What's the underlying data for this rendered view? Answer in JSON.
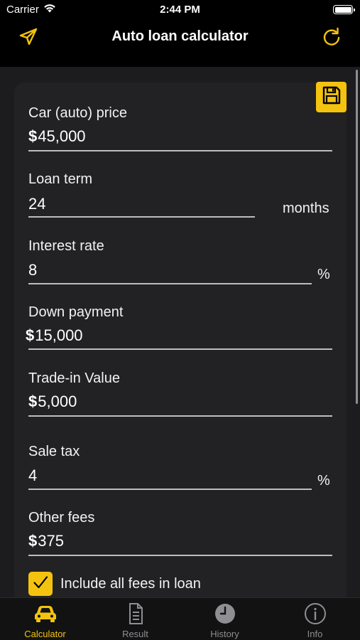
{
  "status_bar": {
    "carrier": "Carrier",
    "time": "2:44 PM"
  },
  "nav": {
    "title": "Auto loan calculator",
    "left_icon": "send-icon",
    "right_icon": "refresh-icon"
  },
  "colors": {
    "accent": "#f4c30f",
    "background": "#000000",
    "panel": "#222224",
    "muted": "#8e8e93"
  },
  "form": {
    "car_price": {
      "label": "Car (auto) price",
      "prefix": "$",
      "value": "45,000"
    },
    "loan_term": {
      "label": "Loan term",
      "value": "24",
      "unit": "months"
    },
    "interest_rate": {
      "label": "Interest rate",
      "value": "8",
      "unit": "%"
    },
    "down_payment": {
      "label": "Down payment",
      "prefix": "$",
      "value": "15,000"
    },
    "trade_in": {
      "label": "Trade-in Value",
      "prefix": "$",
      "value": "5,000"
    },
    "sale_tax": {
      "label": "Sale tax",
      "value": "4",
      "unit": "%"
    },
    "other_fees": {
      "label": "Other fees",
      "prefix": "$",
      "value": "375"
    },
    "include_fees": {
      "label": "Include all fees in loan",
      "checked": true
    }
  },
  "tabs": [
    {
      "label": "Calculator",
      "icon": "car-icon",
      "active": true
    },
    {
      "label": "Result",
      "icon": "document-icon",
      "active": false
    },
    {
      "label": "History",
      "icon": "clock-icon",
      "active": false
    },
    {
      "label": "Info",
      "icon": "info-icon",
      "active": false
    }
  ]
}
